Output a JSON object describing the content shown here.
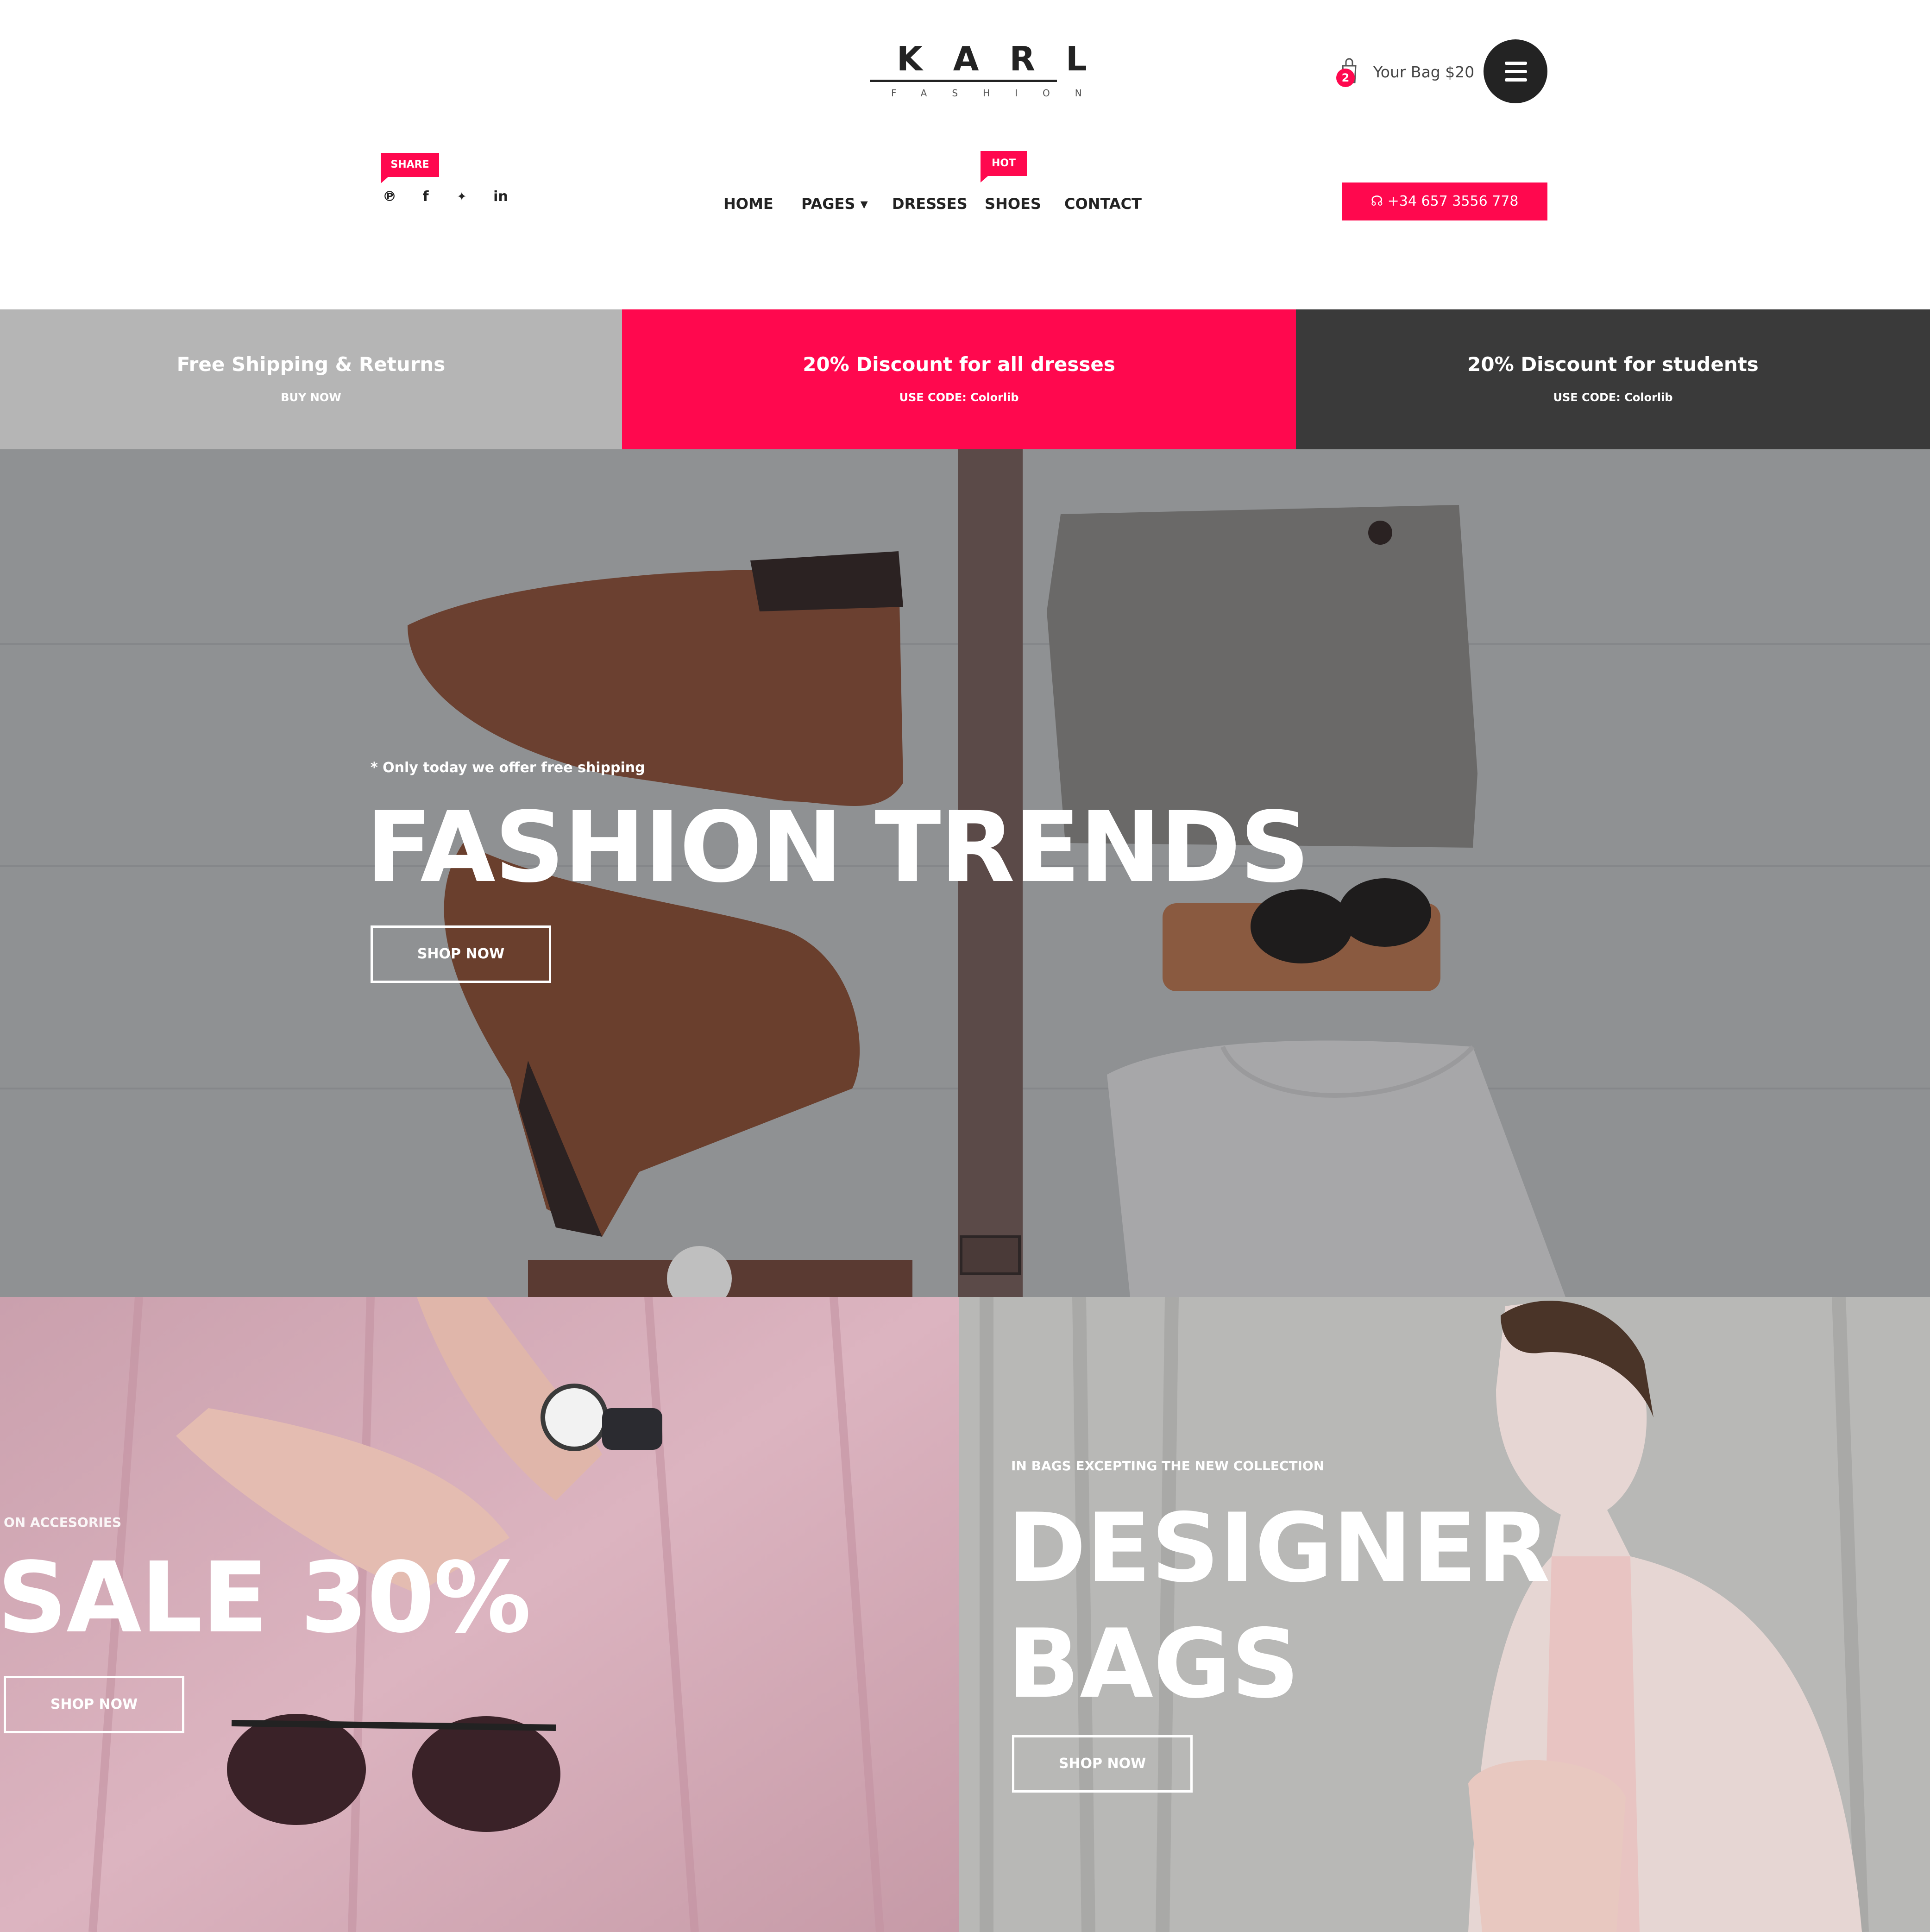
{
  "header": {
    "logo": {
      "main": "KARL",
      "sub": "FASHION"
    },
    "cart": {
      "count": "2",
      "label": "Your Bag $20",
      "icon": "shopping-bag-icon"
    },
    "menu_icon": "hamburger-menu-icon",
    "share_tag": "SHARE",
    "social": [
      {
        "name": "pinterest-icon",
        "glyph": "℗"
      },
      {
        "name": "facebook-icon",
        "glyph": "f"
      },
      {
        "name": "twitter-icon",
        "glyph": "🐦"
      },
      {
        "name": "linkedin-icon",
        "glyph": "in"
      }
    ],
    "nav": {
      "home": "HOME",
      "pages": "PAGES ▾",
      "dresses": "DRESSES",
      "shoes": "SHOES",
      "contact": "CONTACT",
      "hot_tag": "HOT"
    },
    "phone": {
      "icon": "headset-icon",
      "label": "☊ +34 657 3556 778"
    }
  },
  "promos": [
    {
      "title": "Free Shipping & Returns",
      "sub": "BUY NOW",
      "color": "#b5b5b5"
    },
    {
      "title": "20% Discount for all dresses",
      "sub": "USE CODE: Colorlib",
      "color": "#ff084e"
    },
    {
      "title": "20% Discount for students",
      "sub": "USE CODE: Colorlib",
      "color": "#3a3a3a"
    }
  ],
  "hero": {
    "note": "* Only today we offer free shipping",
    "title": "FASHION TRENDS",
    "button": "SHOP NOW"
  },
  "banner_left": {
    "note": "ON ACCESORIES",
    "title": "SALE 30%",
    "button": "SHOP NOW"
  },
  "banner_right": {
    "note": "IN BAGS EXCEPTING THE NEW COLLECTION",
    "title": "DESIGNER BAGS",
    "button": "SHOP NOW"
  },
  "colors": {
    "accent": "#ff084e",
    "dark": "#232323"
  }
}
